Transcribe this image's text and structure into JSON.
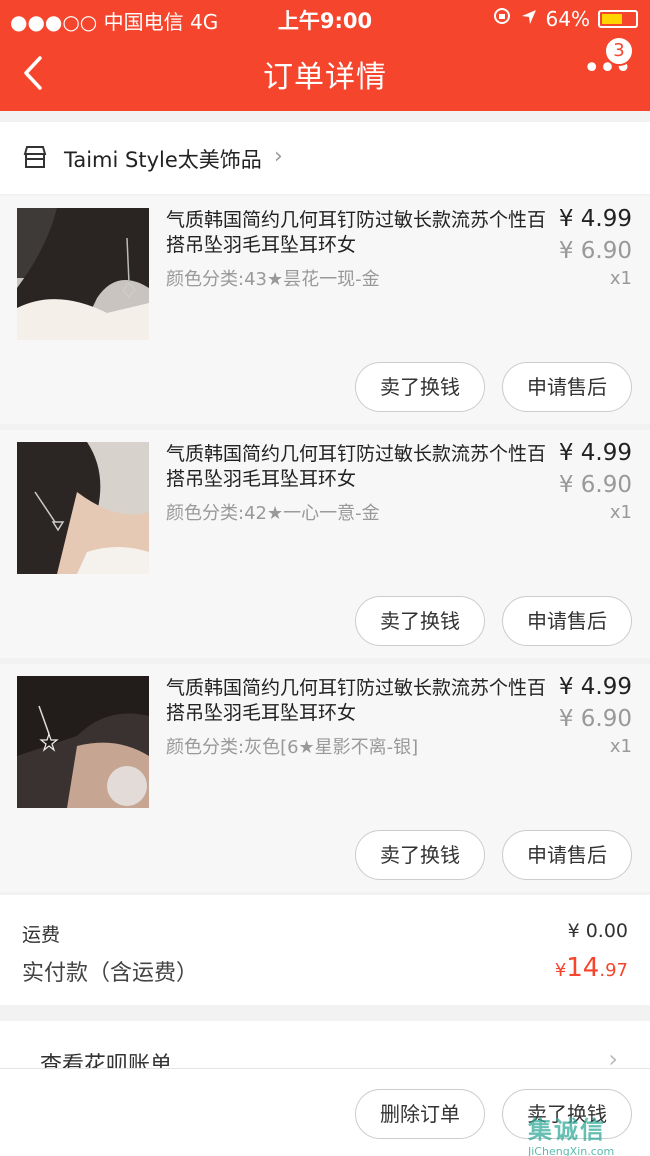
{
  "status_bar": {
    "carrier": "●●●○○ 中国电信   4G",
    "time": "上午9:00",
    "battery": "64%",
    "battery_level": 0.64
  },
  "header": {
    "title": "订单详情",
    "badge": "3"
  },
  "shop": {
    "name": "Taimi Style太美饰品"
  },
  "items": [
    {
      "title": "气质韩国简约几何耳钉防过敏长款流苏个性百搭吊坠羽毛耳坠耳环女",
      "spec": "颜色分类:43★昙花一现-金",
      "price": "¥ 4.99",
      "original_price": "¥ 6.90",
      "qty": "x1",
      "btn_sell": "卖了换钱",
      "btn_aftersale": "申请售后"
    },
    {
      "title": "气质韩国简约几何耳钉防过敏长款流苏个性百搭吊坠羽毛耳坠耳环女",
      "spec": "颜色分类:42★一心一意-金",
      "price": "¥ 4.99",
      "original_price": "¥ 6.90",
      "qty": "x1",
      "btn_sell": "卖了换钱",
      "btn_aftersale": "申请售后"
    },
    {
      "title": "气质韩国简约几何耳钉防过敏长款流苏个性百搭吊坠羽毛耳坠耳环女",
      "spec": "颜色分类:灰色[6★星影不离-银]",
      "price": "¥ 4.99",
      "original_price": "¥ 6.90",
      "qty": "x1",
      "btn_sell": "卖了换钱",
      "btn_aftersale": "申请售后"
    }
  ],
  "fees": {
    "shipping_label": "运费",
    "shipping_value": "¥ 0.00",
    "paid_label": "实付款（含运费）",
    "paid_currency": "¥",
    "paid_int": "14",
    "paid_dec": ".97"
  },
  "huabei": {
    "label": "查看花呗账单"
  },
  "bottom": {
    "delete_label": "删除订单",
    "sell_label": "卖了换钱"
  },
  "watermark": {
    "big": "集诚信",
    "small": "JiChengXin.com"
  },
  "colors": {
    "accent": "#f5452d"
  }
}
